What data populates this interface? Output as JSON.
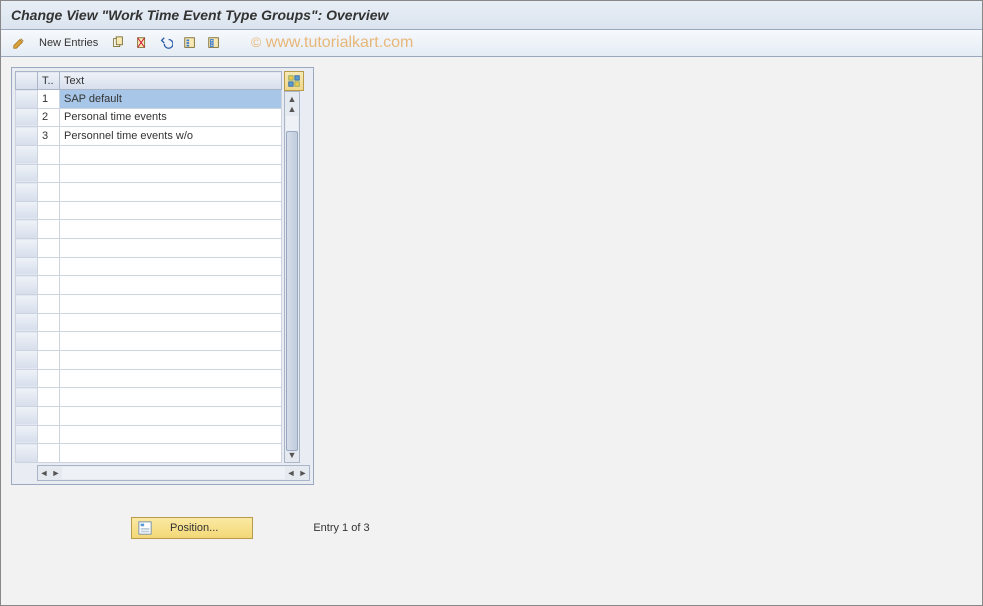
{
  "title": "Change View \"Work Time Event Type Groups\": Overview",
  "watermark": "www.tutorialkart.com",
  "toolbar": {
    "new_entries": "New Entries",
    "icons": [
      "pencil-icon",
      "copy-icon",
      "delete-icon",
      "undo-icon",
      "select-all-icon",
      "deselect-all-icon"
    ]
  },
  "table": {
    "headers": {
      "t": "T..",
      "text": "Text"
    },
    "rows": [
      {
        "t": "1",
        "text": "SAP default",
        "selected": true
      },
      {
        "t": "2",
        "text": "Personal time events",
        "selected": false
      },
      {
        "t": "3",
        "text": "Personnel time events w/o",
        "selected": false
      }
    ],
    "empty_rows": 17
  },
  "footer": {
    "position_label": "Position...",
    "entry_text": "Entry 1 of 3"
  },
  "colors": {
    "accent": "#f3d877",
    "select": "#a8c7e8"
  }
}
